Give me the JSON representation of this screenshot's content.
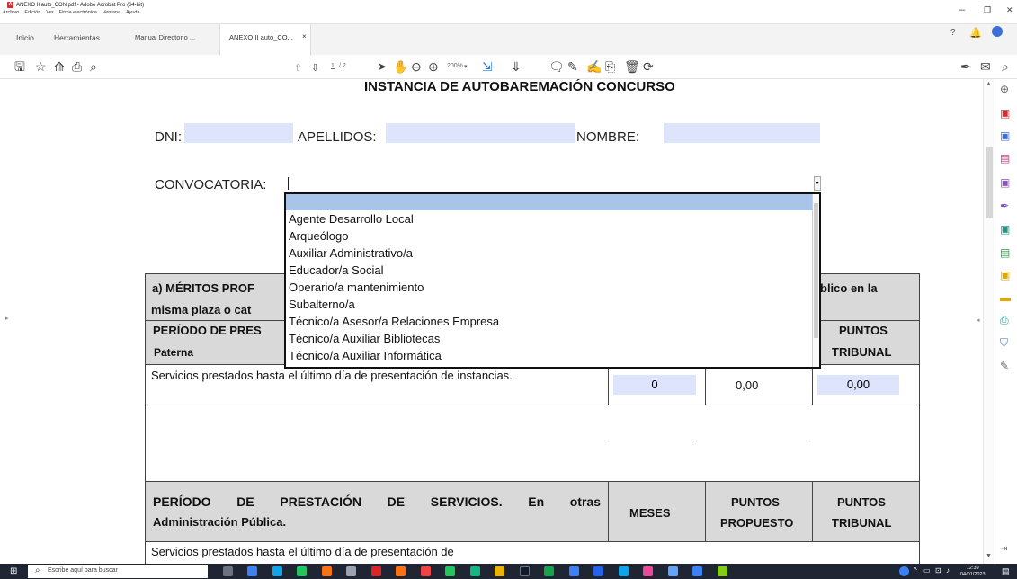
{
  "window": {
    "title": "ANEXO II auto_CON.pdf - Adobe Acrobat Pro (64-bit)",
    "menus": [
      "Archivo",
      "Edición",
      "Ver",
      "Firma electrónica",
      "Ventana",
      "Ayuda"
    ],
    "controls": {
      "minimize": "–",
      "restore": "❐",
      "close": "✕"
    }
  },
  "tabs": {
    "home": "Inicio",
    "tools": "Herramientas",
    "doc1": "Manual Directorio ...",
    "doc2": "ANEXO II auto_CO...",
    "doc2_close": "×"
  },
  "toolbar": {
    "page_current": "1",
    "page_total": "/ 2",
    "zoom": "200%",
    "zoom_caret": "▾"
  },
  "document": {
    "title": "INSTANCIA DE AUTOBAREMACIÓN CONCURSO",
    "dni_label": "DNI:",
    "apellidos_label": "APELLIDOS:",
    "nombre_label": "NOMBRE:",
    "convocatoria_label": "CONVOCATORIA:",
    "section_a_line1": "a) MÉRITOS PROF",
    "section_a_line1_tail": "blico en la",
    "section_a_line2": "misma plaza o cat",
    "periodo_line1": "PERÍODO DE PRES",
    "periodo_line2": "Paterna",
    "puntos_tribunal_1": "PUNTOS",
    "puntos_tribunal_2": "TRIBUNAL",
    "servicios_row": "Servicios prestados hasta el último día de presentación de instancias.",
    "meses_value": "0",
    "puntos_propuesto_value": "0,00",
    "puntos_tribunal_value": "0,00",
    "dot": ".",
    "periodo2_line1": "PERÍODO DE PRESTACIÓN DE SERVICIOS. En otras",
    "periodo2_line2": "Administración Pública.",
    "meses_header": "MESES",
    "puntos_propuesto_1": "PUNTOS",
    "puntos_propuesto_2": "PROPUESTO",
    "servicios_row2": "Servicios prestados hasta el último día de presentación de"
  },
  "dropdown": {
    "options": [
      "Agente Desarrollo Local",
      "Arqueólogo",
      "Auxiliar Administrativo/a",
      "Educador/a Social",
      "Operario/a mantenimiento",
      "Subalterno/a",
      "Técnico/a Asesor/a Relaciones Empresa",
      "Técnico/a Auxiliar Bibliotecas",
      "Técnico/a Auxiliar Informática"
    ]
  },
  "taskbar": {
    "search_placeholder": "Escribe aquí para buscar",
    "time": "12:39",
    "date": "04/01/2023"
  }
}
